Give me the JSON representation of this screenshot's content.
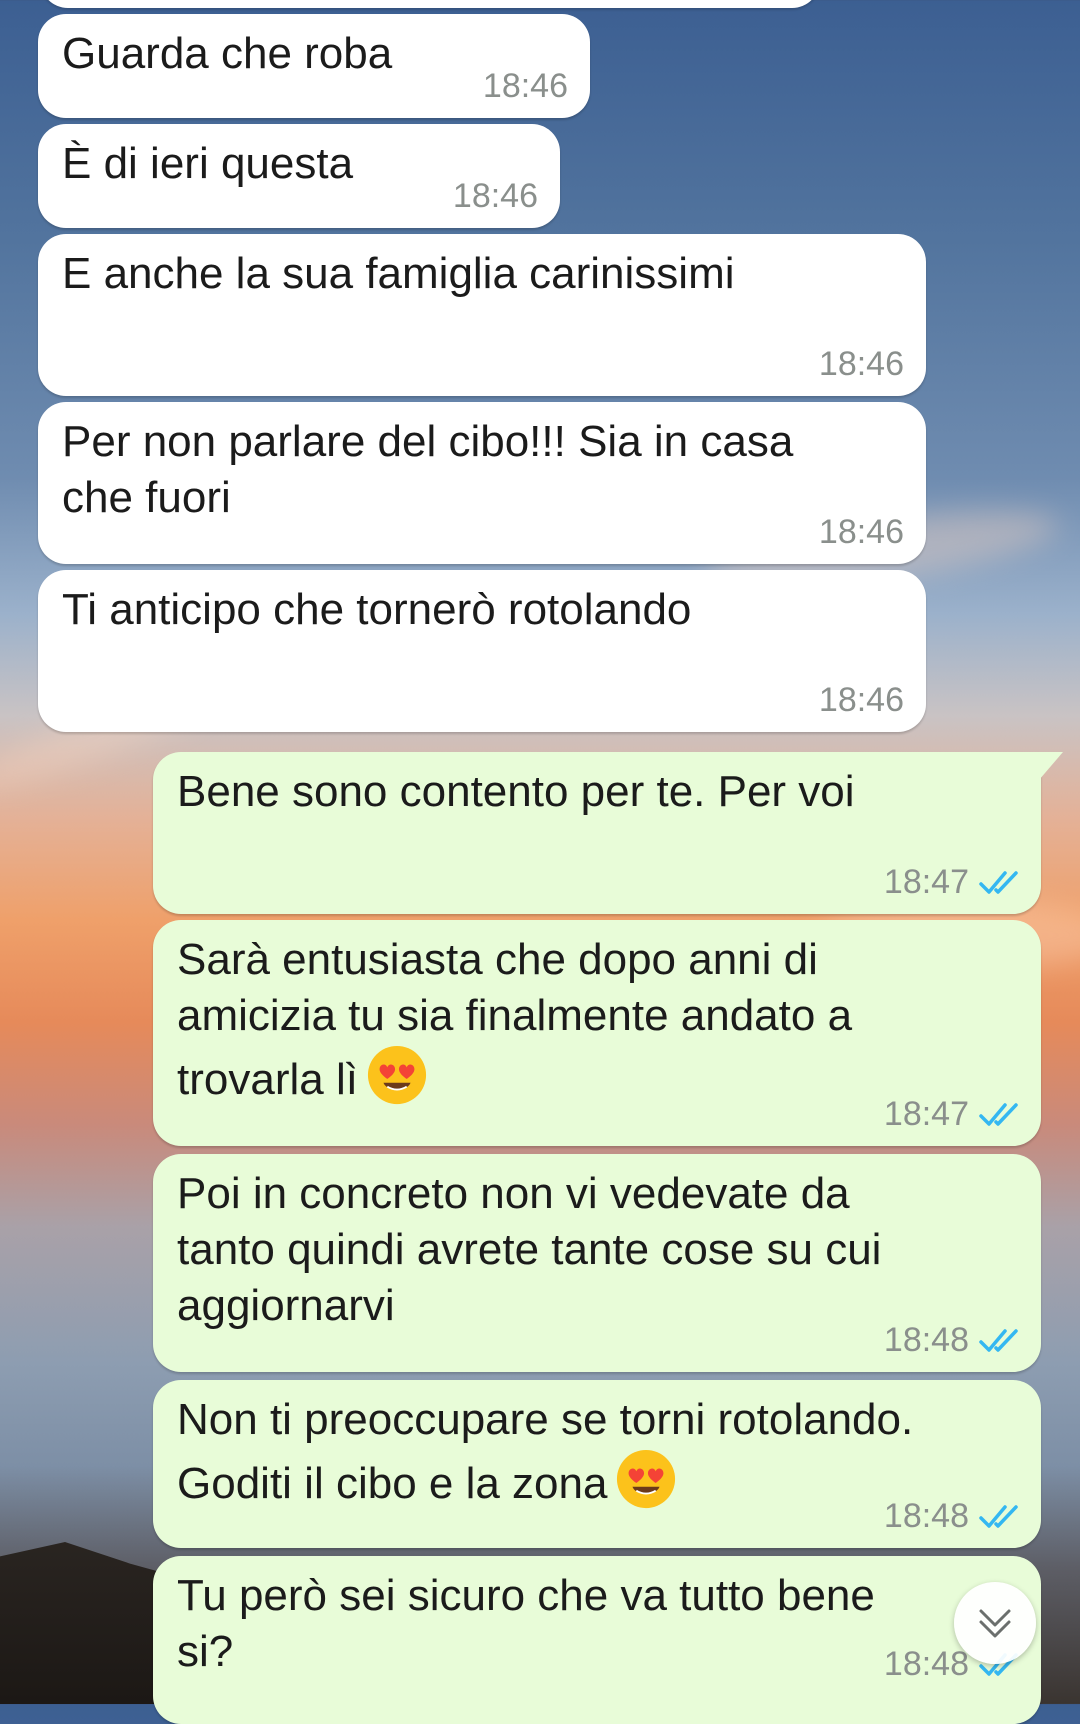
{
  "chat": {
    "received": [
      {
        "text": "Guarda che roba",
        "time": "18:46"
      },
      {
        "text": "È di ieri questa",
        "time": "18:46"
      },
      {
        "text": "E anche la sua famiglia carinissimi",
        "time": "18:46"
      },
      {
        "text": "Per non parlare del cibo!!! Sia in casa\nche fuori",
        "time": "18:46"
      },
      {
        "text": "Ti anticipo che tornerò rotolando",
        "time": "18:46"
      }
    ],
    "sent": [
      {
        "text": "Bene sono contento per te. Per voi",
        "time": "18:47"
      },
      {
        "text": "Sarà entusiasta che dopo anni di\namicizia tu sia finalmente andato a\ntrovarla lì",
        "time": "18:47",
        "emoji": "heart-eyes-emoji"
      },
      {
        "text": "Poi in concreto non vi vedevate da\ntanto quindi avrete tante cose su cui\naggiornarvi",
        "time": "18:48"
      },
      {
        "text": "Non ti preoccupare se torni rotolando.\nGoditi il cibo e la zona",
        "time": "18:48",
        "emoji": "heart-eyes-emoji"
      },
      {
        "text": "Tu però sei sicuro che va tutto bene\nsi?",
        "time": "18:48"
      }
    ]
  },
  "icons": {
    "read_ticks": "double-check-icon",
    "scroll_down": "chevron-double-down-icon"
  },
  "colors": {
    "incoming_bubble": "#ffffff",
    "outgoing_bubble": "#e8fcd8",
    "read_tick": "#34b7f1",
    "timestamp": "#8a8f8c"
  }
}
